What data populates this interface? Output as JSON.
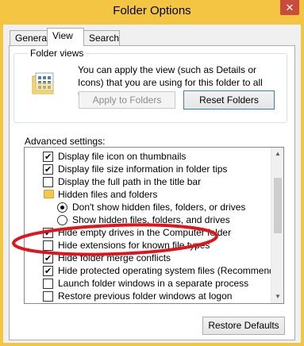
{
  "window": {
    "title": "Folder Options",
    "close_glyph": "✕"
  },
  "tabs": [
    {
      "label": "General"
    },
    {
      "label": "View"
    },
    {
      "label": "Search"
    }
  ],
  "folder_views": {
    "legend": "Folder views",
    "description": "You can apply the view (such as Details or Icons) that you are using for this folder to all folders of this type.",
    "apply_button": "Apply to Folders",
    "reset_button": "Reset Folders"
  },
  "advanced": {
    "label": "Advanced settings:",
    "items": [
      {
        "type": "checkbox",
        "checked": true,
        "label": "Display file icon on thumbnails"
      },
      {
        "type": "checkbox",
        "checked": true,
        "label": "Display file size information in folder tips"
      },
      {
        "type": "checkbox",
        "checked": false,
        "label": "Display the full path in the title bar"
      },
      {
        "type": "folder",
        "label": "Hidden files and folders"
      },
      {
        "type": "radio",
        "checked": true,
        "label": "Don't show hidden files, folders, or drives"
      },
      {
        "type": "radio",
        "checked": false,
        "label": "Show hidden files, folders, and drives"
      },
      {
        "type": "checkbox",
        "checked": true,
        "label": "Hide empty drives in the Computer folder"
      },
      {
        "type": "checkbox",
        "checked": false,
        "label": "Hide extensions for known file types"
      },
      {
        "type": "checkbox",
        "checked": true,
        "label": "Hide folder merge conflicts"
      },
      {
        "type": "checkbox",
        "checked": true,
        "label": "Hide protected operating system files (Recommended)"
      },
      {
        "type": "checkbox",
        "checked": false,
        "label": "Launch folder windows in a separate process"
      },
      {
        "type": "checkbox",
        "checked": false,
        "label": "Restore previous folder windows at logon"
      }
    ]
  },
  "restore_button": "Restore Defaults",
  "colors": {
    "title_bar": "#f4c542",
    "annotation": "#e0141b",
    "close": "#c94b3b"
  }
}
